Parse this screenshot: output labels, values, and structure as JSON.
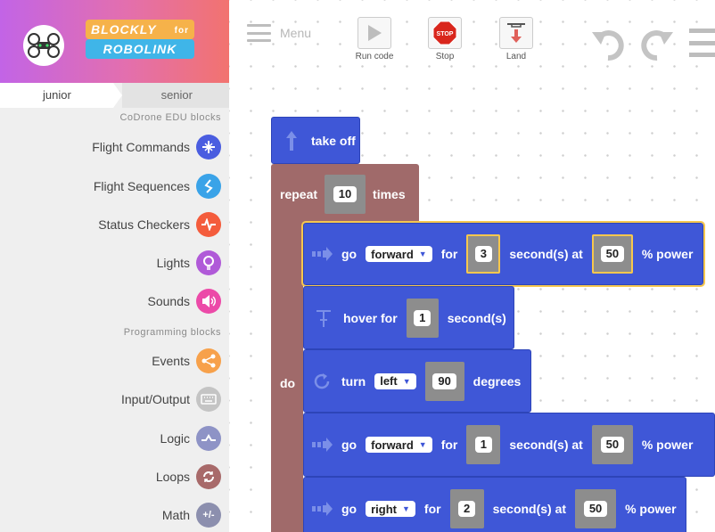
{
  "brand": {
    "logo_top": "BLOCKLY",
    "logo_for": "for",
    "logo_bottom": "ROBOLINK"
  },
  "level_tabs": {
    "junior": "junior",
    "senior": "senior"
  },
  "sidebar": {
    "section_codrone": "CoDrone EDU blocks",
    "section_programming": "Programming blocks",
    "categories": [
      {
        "label": "Flight Commands",
        "icon": "flight-commands-icon",
        "color": "#4a5de0"
      },
      {
        "label": "Flight Sequences",
        "icon": "flight-sequences-icon",
        "color": "#3aa3e8"
      },
      {
        "label": "Status Checkers",
        "icon": "pulse-icon",
        "color": "#f45c3c"
      },
      {
        "label": "Lights",
        "icon": "bulb-icon",
        "color": "#b05ad8"
      },
      {
        "label": "Sounds",
        "icon": "speaker-icon",
        "color": "#ec4aa8"
      },
      {
        "label": "Events",
        "icon": "share-icon",
        "color": "#f7a14b"
      },
      {
        "label": "Input/Output",
        "icon": "keyboard-icon",
        "color": "#c4c4c4"
      },
      {
        "label": "Logic",
        "icon": "logic-icon",
        "color": "#8e93c6"
      },
      {
        "label": "Loops",
        "icon": "loop-icon",
        "color": "#a86a6a"
      },
      {
        "label": "Math",
        "icon": "math-icon",
        "icon_text": "+/-",
        "color": "#8c8fae"
      }
    ]
  },
  "toolbar": {
    "menu_label": "Menu",
    "run_label": "Run code",
    "stop_label": "Stop",
    "stop_sign_text": "STOP",
    "land_label": "Land"
  },
  "blocks": {
    "takeoff": {
      "label": "take off"
    },
    "repeat": {
      "label": "repeat",
      "count": "10",
      "times": "times",
      "do": "do"
    },
    "go1": {
      "go": "go",
      "direction": "forward",
      "for": "for",
      "seconds": "3",
      "at": "second(s) at",
      "power": "50",
      "power_label": "% power"
    },
    "hover": {
      "label": "hover for",
      "seconds": "1",
      "unit": "second(s)"
    },
    "turn": {
      "label": "turn",
      "direction": "left",
      "degrees": "90",
      "unit": "degrees"
    },
    "go2": {
      "go": "go",
      "direction": "forward",
      "for": "for",
      "seconds": "1",
      "at": "second(s) at",
      "power": "50",
      "power_label": "% power"
    },
    "go3": {
      "go": "go",
      "direction": "right",
      "for": "for",
      "seconds": "2",
      "at": "second(s) at",
      "power": "50",
      "power_label": "% power"
    }
  }
}
